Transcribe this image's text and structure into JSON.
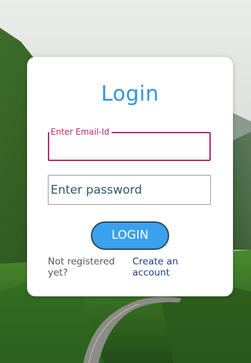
{
  "login": {
    "title": "Login",
    "email_label": "Enter Email-Id",
    "email_value": "",
    "password_placeholder": "Enter password",
    "login_button": "LOGIN",
    "not_registered_text": "Not registered yet?",
    "create_account_link": "Create an account"
  },
  "colors": {
    "title": "#2f95dc",
    "email_border_focus": "#b6286b",
    "button_bg": "#3aa1ee",
    "button_border": "#2b4a58",
    "link": "#1f3a8a"
  }
}
